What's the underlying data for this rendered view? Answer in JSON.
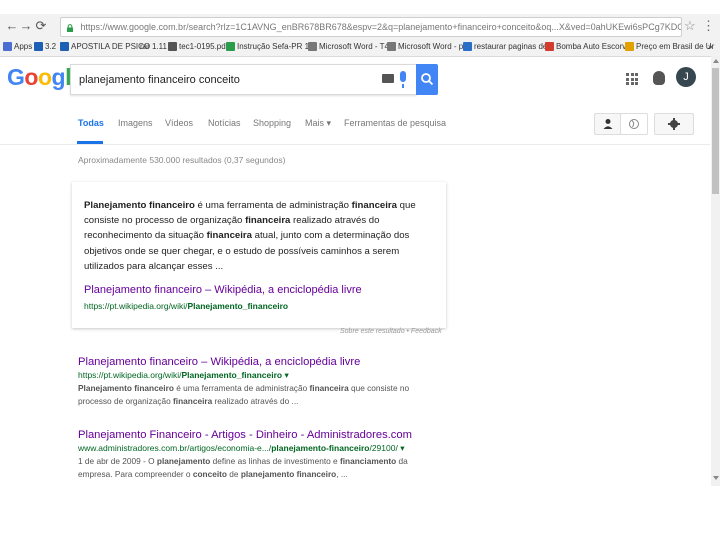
{
  "browser": {
    "url": "https://www.google.com.br/search?rlz=1C1AVNG_enBR678BR678&espv=2&q=planejamento+financeiro+conceito&oq...X&ved=0ahUKEwi6sPCg7KDOAhVJk5AKHeahDLQQ1QIhIn",
    "bookmarks": [
      {
        "label": "Apps",
        "color": "#4a6fd1"
      },
      {
        "label": "3.2",
        "color": "#1c5fb5"
      },
      {
        "label": "APOSTILA DE PSICO",
        "color": "#1c5fb5"
      },
      {
        "label": "rar 1.11",
        "color": "#666666"
      },
      {
        "label": "tec1-0195.pdf",
        "color": "#555555"
      },
      {
        "label": "Instrução Sefa-PR 14",
        "color": "#2a9d4b"
      },
      {
        "label": "Microsoft Word - T4",
        "color": "#777777"
      },
      {
        "label": "Microsoft Word - plo",
        "color": "#777777"
      },
      {
        "label": "restaurar paginas de",
        "color": "#2a6fc7"
      },
      {
        "label": "Bomba Auto Escorva",
        "color": "#d23b2d"
      },
      {
        "label": "Preço em Brasil de Ur",
        "color": "#e2a100"
      }
    ]
  },
  "header": {
    "logo": "Google",
    "query": "planejamento financeiro conceito",
    "avatar_initial": "J"
  },
  "tabs": [
    "Todas",
    "Imagens",
    "Vídeos",
    "Notícias",
    "Shopping",
    "Mais ▾",
    "Ferramentas de pesquisa"
  ],
  "stats": "Aproximadamente 530.000 resultados (0,37 segundos)",
  "featured": {
    "link": "Planejamento financeiro – Wikipédia, a enciclopédia livre",
    "url_prefix": "https://pt.wikipedia.org/wiki/",
    "url_bold": "Planejamento_financeiro",
    "feedback": "Sobre este resultado • Feedback"
  },
  "results": [
    {
      "title": "Planejamento financeiro – Wikipédia, a enciclopédia livre",
      "url_prefix": "https://pt.wikipedia.org/wiki/",
      "url_bold": "Planejamento_financeiro",
      "url_suffix": " ▾"
    },
    {
      "title": "Planejamento Financeiro - Artigos - Dinheiro - Administradores.com",
      "url_prefix": "www.administradores.com.br/artigos/economia-e.../",
      "url_bold": "planejamento-financeiro",
      "url_suffix": "/29100/ ▾"
    }
  ]
}
